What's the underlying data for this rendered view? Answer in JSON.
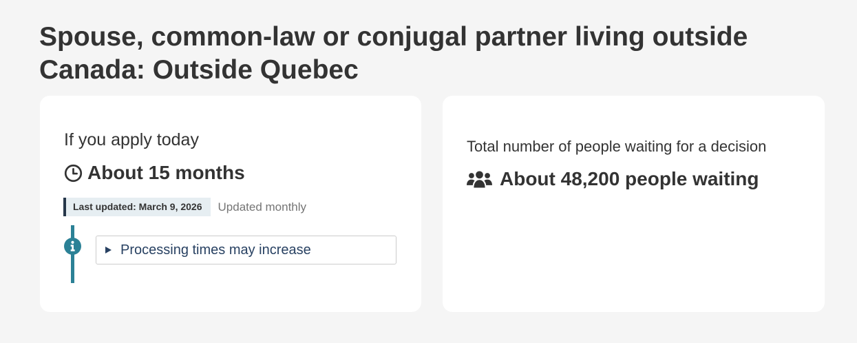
{
  "page": {
    "title": "Spouse, common-law or conjugal partner living outside Canada: Outside Quebec"
  },
  "processing_card": {
    "heading": "If you apply today",
    "time_icon": "clock-icon",
    "time_value": "About 15 months",
    "last_updated": "Last updated: March 9, 2026",
    "update_frequency": "Updated monthly",
    "info_icon": "info-icon",
    "details_summary": "Processing times may increase"
  },
  "waiting_card": {
    "heading": "Total number of people waiting for a decision",
    "people_icon": "users-icon",
    "waiting_value": "About 48,200 people waiting"
  },
  "colors": {
    "background": "#f5f5f5",
    "card": "#ffffff",
    "text": "#333333",
    "accent_teal": "#2b8196",
    "badge_border": "#26374a",
    "badge_background": "#e6eef2",
    "link": "#284162",
    "muted": "#757575"
  }
}
